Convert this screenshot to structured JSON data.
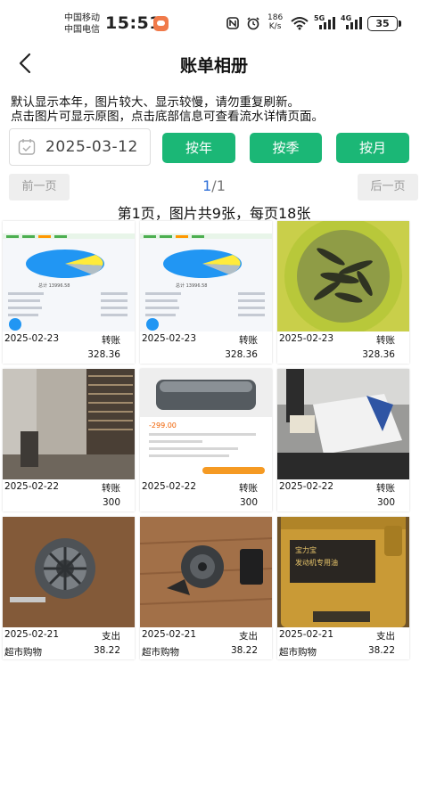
{
  "status_bar": {
    "carrier_1": "中国移动",
    "carrier_2": "中国电信",
    "time": "15:51",
    "net_speed_value": "186",
    "net_speed_unit": "K/s",
    "sig1_label": "5G",
    "sig2_label": "4G",
    "battery": "35"
  },
  "header": {
    "title": "账单相册"
  },
  "notice": {
    "line1": "默认显示本年，图片较大、显示较慢，请勿重复刷新。",
    "line2": "点击图片可显示原图，点击底部信息可查看流水详情页面。"
  },
  "filter": {
    "date": "2025-03-12",
    "by_year": "按年",
    "by_quarter": "按季",
    "by_month": "按月"
  },
  "pagination": {
    "prev": "前一页",
    "next": "后一页",
    "current": "1",
    "total": "/1",
    "summary": "第1页，图片共9张，每页18张"
  },
  "cards": [
    {
      "date": "2025-02-23",
      "type": "转账",
      "desc": "",
      "amount": "328.36",
      "photo": "app-screenshot-pie-chart"
    },
    {
      "date": "2025-02-23",
      "type": "转账",
      "desc": "",
      "amount": "328.36",
      "photo": "app-screenshot-pie-chart"
    },
    {
      "date": "2025-02-23",
      "type": "转账",
      "desc": "",
      "amount": "328.36",
      "photo": "fish-basin"
    },
    {
      "date": "2025-02-22",
      "type": "转账",
      "desc": "",
      "amount": "300",
      "photo": "balcony-doorway"
    },
    {
      "date": "2025-02-22",
      "type": "转账",
      "desc": "",
      "amount": "300",
      "photo": "shopping-order-screenshot"
    },
    {
      "date": "2025-02-22",
      "type": "转账",
      "desc": "",
      "amount": "300",
      "photo": "desk-with-papers"
    },
    {
      "date": "2025-02-21",
      "type": "支出",
      "desc": "超市购物",
      "amount": "38.22",
      "photo": "alternator"
    },
    {
      "date": "2025-02-21",
      "type": "支出",
      "desc": "超市购物",
      "amount": "38.22",
      "photo": "alternator-on-floor"
    },
    {
      "date": "2025-02-21",
      "type": "支出",
      "desc": "超市购物",
      "amount": "38.22",
      "photo": "engine-oil-can"
    }
  ],
  "photo_texts": {
    "chart_total": "总计 13996.58",
    "order_price": "-299.00",
    "oil_label_1": "宝力宝",
    "oil_label_2": "发动机专用油"
  },
  "colors": {
    "accent_green": "#1bb776",
    "page_number_blue": "#2e6fd8",
    "pager_gray": "#eeeeee"
  }
}
